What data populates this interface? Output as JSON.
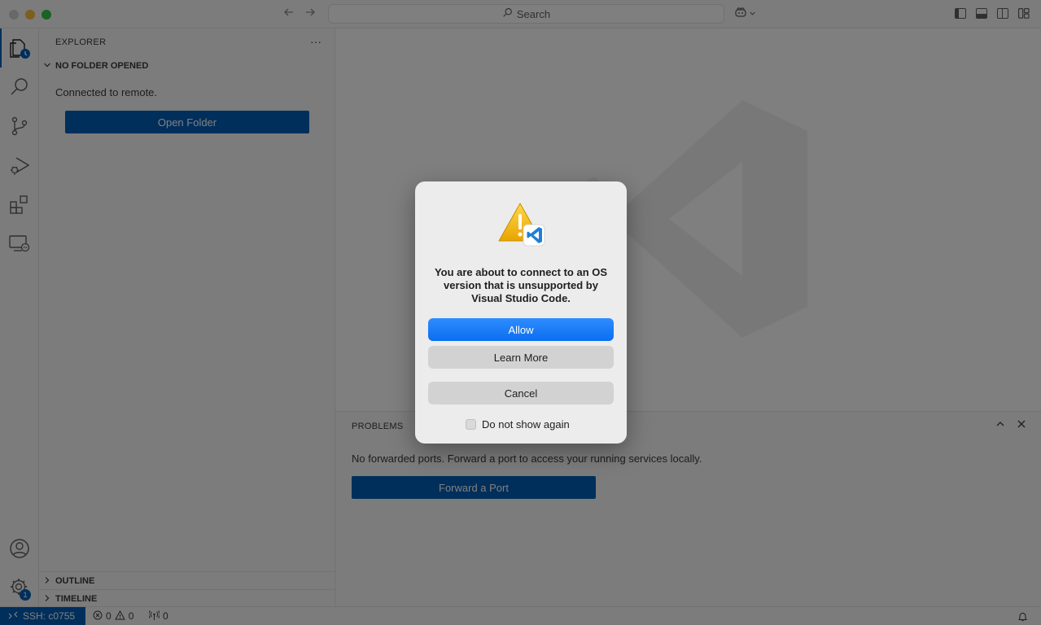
{
  "titlebar": {
    "search_placeholder": "Search",
    "nav_back_icon": "arrow-left-icon",
    "nav_forward_icon": "arrow-right-icon"
  },
  "sidebar": {
    "title": "EXPLORER",
    "section_no_folder": "NO FOLDER OPENED",
    "connected_text": "Connected to remote.",
    "open_folder_label": "Open Folder",
    "outline_label": "OUTLINE",
    "timeline_label": "TIMELINE"
  },
  "activitybar": {
    "settings_badge": "1"
  },
  "panel": {
    "tab_label": "PROBLEMS",
    "message": "No forwarded ports. Forward a port to access your running services locally.",
    "forward_button": "Forward a Port"
  },
  "statusbar": {
    "remote_label": "SSH: c0755",
    "errors": "0",
    "warnings": "0",
    "ports": "0"
  },
  "dialog": {
    "message": "You are about to connect to an OS version that is unsupported by Visual Studio Code.",
    "allow_label": "Allow",
    "learn_more_label": "Learn More",
    "cancel_label": "Cancel",
    "dont_show_label": "Do not show again"
  },
  "colors": {
    "accent": "#005fb8",
    "dialog_primary": "#0a6ef0",
    "traffic_min": "#fdbc40",
    "traffic_max": "#33c748"
  }
}
